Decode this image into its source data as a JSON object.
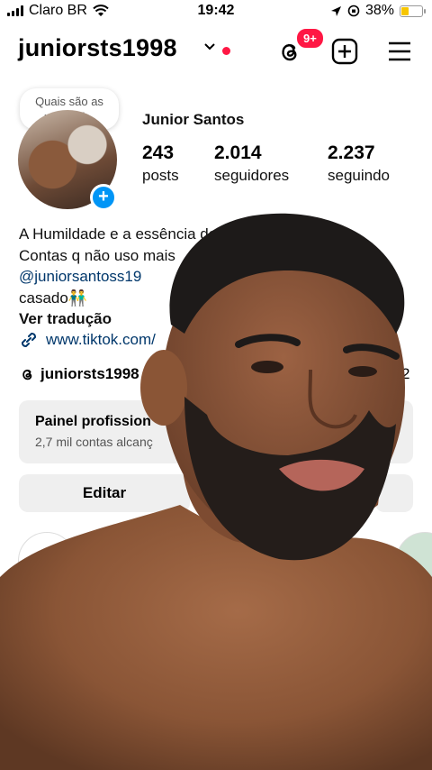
{
  "status_bar": {
    "carrier": "Claro BR",
    "time": "19:42",
    "battery": "38%",
    "battery_level": 0.38
  },
  "header": {
    "username": "juniorsts1998",
    "notifications_badge": "9+",
    "badge_color": "#ff1744"
  },
  "profile": {
    "note": "Quais são as novidad...",
    "display_name": "Junior Santos",
    "stats": [
      {
        "value": "243",
        "label": "posts"
      },
      {
        "value": "2.014",
        "label": "seguidores"
      },
      {
        "value": "2.237",
        "label": "seguindo"
      }
    ],
    "bio": {
      "line1": "A Humildade e a essência da",
      "line2": "Contas q não uso mais",
      "mention": "@juniorsantoss19",
      "line4": "casado👬",
      "translate": "Ver tradução"
    },
    "link": "www.tiktok.com/",
    "threads_handle": "juniorsts1998",
    "threads_count_fragment": "2"
  },
  "professional_panel": {
    "title": "Painel profission",
    "subtitle": "2,7 mil contas alcanç"
  },
  "actions": {
    "edit": "Editar"
  },
  "colors": {
    "accent": "#0095f6",
    "link": "#00376b",
    "panel_bg": "#efefef"
  },
  "icons": [
    "wifi-icon",
    "location-icon",
    "rotation-lock-icon",
    "threads-icon",
    "add-post-icon",
    "menu-icon",
    "link-icon",
    "chevron-down-icon"
  ]
}
